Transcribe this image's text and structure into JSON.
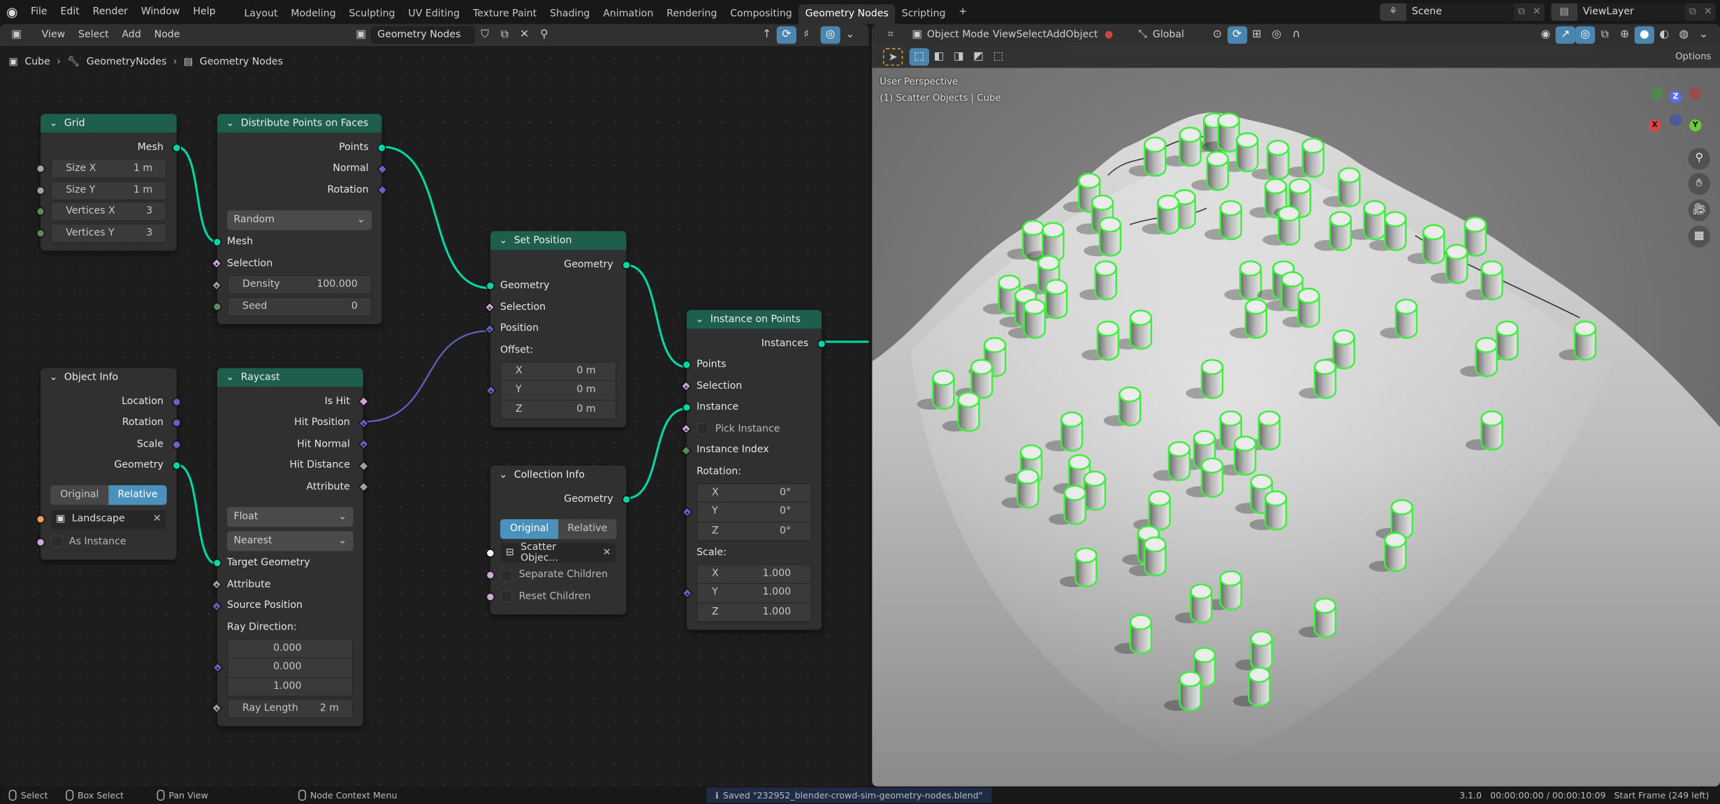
{
  "top_bar": {
    "menu": [
      "File",
      "Edit",
      "Render",
      "Window",
      "Help"
    ],
    "workspaces": [
      "Layout",
      "Modeling",
      "Sculpting",
      "UV Editing",
      "Texture Paint",
      "Shading",
      "Animation",
      "Rendering",
      "Compositing",
      "Geometry Nodes",
      "Scripting"
    ],
    "active_workspace": "Geometry Nodes",
    "add_tab": "+",
    "scene": "Scene",
    "view_layer": "ViewLayer"
  },
  "node_editor": {
    "header_menu": [
      "View",
      "Select",
      "Add",
      "Node"
    ],
    "node_tree": "Geometry Nodes",
    "breadcrumb": [
      "Cube",
      "GeometryNodes",
      "Geometry Nodes"
    ],
    "nodes": [
      {
        "id": "grid",
        "title": "Grid",
        "color": "#1d5e4c",
        "rows": [
          {
            "t": "out",
            "label": "Mesh",
            "s": "geo"
          },
          {
            "t": "field",
            "label": "Size X",
            "value": "1 m",
            "s": "float"
          },
          {
            "t": "field",
            "label": "Size Y",
            "value": "1 m",
            "s": "float"
          },
          {
            "t": "field",
            "label": "Vertices X",
            "value": "3",
            "s": "int"
          },
          {
            "t": "field",
            "label": "Vertices Y",
            "value": "3",
            "s": "int"
          }
        ]
      },
      {
        "id": "distribute",
        "title": "Distribute Points on Faces",
        "color": "#1d5e4c",
        "rows": [
          {
            "t": "out",
            "label": "Points",
            "s": "geo"
          },
          {
            "t": "out",
            "label": "Normal",
            "s": "vec"
          },
          {
            "t": "out",
            "label": "Rotation",
            "s": "vec"
          },
          {
            "t": "drop",
            "value": "Random"
          },
          {
            "t": "in",
            "label": "Mesh",
            "s": "geo"
          },
          {
            "t": "in",
            "label": "Selection",
            "s": "boolf"
          },
          {
            "t": "field",
            "label": "Density",
            "value": "100.000",
            "s": "floatf"
          },
          {
            "t": "field",
            "label": "Seed",
            "value": "0",
            "s": "int"
          }
        ]
      },
      {
        "id": "setpos",
        "title": "Set Position",
        "color": "#1d5e4c",
        "rows": [
          {
            "t": "out",
            "label": "Geometry",
            "s": "geo"
          },
          {
            "t": "in",
            "label": "Geometry",
            "s": "geo"
          },
          {
            "t": "in",
            "label": "Selection",
            "s": "boolf"
          },
          {
            "t": "in",
            "label": "Position",
            "s": "vecd"
          },
          {
            "t": "label",
            "label": "Offset:"
          },
          {
            "t": "vec",
            "s": "vecf",
            "items": [
              [
                "X",
                "0 m"
              ],
              [
                "Y",
                "0 m"
              ],
              [
                "Z",
                "0 m"
              ]
            ]
          }
        ]
      },
      {
        "id": "iop",
        "title": "Instance on Points",
        "color": "#1d5e4c",
        "rows": [
          {
            "t": "out",
            "label": "Instances",
            "s": "geo"
          },
          {
            "t": "in",
            "label": "Points",
            "s": "geo"
          },
          {
            "t": "in",
            "label": "Selection",
            "s": "boolf"
          },
          {
            "t": "in",
            "label": "Instance",
            "s": "geo"
          },
          {
            "t": "check",
            "label": "Pick Instance",
            "s": "boolf"
          },
          {
            "t": "in",
            "label": "Instance Index",
            "s": "intd"
          },
          {
            "t": "label",
            "label": "Rotation:"
          },
          {
            "t": "vec",
            "s": "vecf",
            "items": [
              [
                "X",
                "0°"
              ],
              [
                "Y",
                "0°"
              ],
              [
                "Z",
                "0°"
              ]
            ]
          },
          {
            "t": "label",
            "label": "Scale:"
          },
          {
            "t": "vec",
            "s": "vecf",
            "items": [
              [
                "X",
                "1.000"
              ],
              [
                "Y",
                "1.000"
              ],
              [
                "Z",
                "1.000"
              ]
            ]
          }
        ]
      },
      {
        "id": "objinfo",
        "title": "Object Info",
        "color": "#303030",
        "rows": [
          {
            "t": "out",
            "label": "Location",
            "s": "vecc"
          },
          {
            "t": "out",
            "label": "Rotation",
            "s": "vecc"
          },
          {
            "t": "out",
            "label": "Scale",
            "s": "vecc"
          },
          {
            "t": "out",
            "label": "Geometry",
            "s": "geo"
          },
          {
            "t": "toggle",
            "options": [
              "Original",
              "Relative"
            ],
            "active": 1
          },
          {
            "t": "obj",
            "value": "Landscape",
            "icon": "object",
            "s": "object"
          },
          {
            "t": "check",
            "label": "As Instance",
            "s": "bool"
          }
        ]
      },
      {
        "id": "raycast",
        "title": "Raycast",
        "color": "#1d5e4c",
        "rows": [
          {
            "t": "out",
            "label": "Is Hit",
            "s": "boold"
          },
          {
            "t": "out",
            "label": "Hit Position",
            "s": "vecd"
          },
          {
            "t": "out",
            "label": "Hit Normal",
            "s": "vecd"
          },
          {
            "t": "out",
            "label": "Hit Distance",
            "s": "floatd"
          },
          {
            "t": "out",
            "label": "Attribute",
            "s": "floatd"
          },
          {
            "t": "drop",
            "value": "Float"
          },
          {
            "t": "drop",
            "value": "Nearest"
          },
          {
            "t": "in",
            "label": "Target Geometry",
            "s": "geo"
          },
          {
            "t": "in",
            "label": "Attribute",
            "s": "floatf"
          },
          {
            "t": "in",
            "label": "Source Position",
            "s": "vecd"
          },
          {
            "t": "label",
            "label": "Ray Direction:"
          },
          {
            "t": "vec",
            "s": "vecf",
            "center": true,
            "items": [
              [
                "",
                "0.000"
              ],
              [
                "",
                "0.000"
              ],
              [
                "",
                "1.000"
              ]
            ]
          },
          {
            "t": "field",
            "label": "Ray Length",
            "value": "2 m",
            "s": "floatf"
          }
        ]
      },
      {
        "id": "collinfo",
        "title": "Collection Info",
        "color": "#303030",
        "rows": [
          {
            "t": "out",
            "label": "Geometry",
            "s": "geo"
          },
          {
            "t": "toggle",
            "options": [
              "Original",
              "Relative"
            ],
            "active": 0
          },
          {
            "t": "obj",
            "value": "Scatter Objec...",
            "icon": "collection",
            "s": "collection"
          },
          {
            "t": "check",
            "label": "Separate Children",
            "s": "bool"
          },
          {
            "t": "check",
            "label": "Reset Children",
            "s": "bool"
          }
        ]
      }
    ]
  },
  "viewport": {
    "mode": "Object Mode",
    "header_menu": [
      "View",
      "Select",
      "Add",
      "Object"
    ],
    "orientation": "Global",
    "options": "Options",
    "overlay_line1": "User Perspective",
    "overlay_line2": "(1) Scatter Objects | Cube",
    "gizmo": {
      "x": "X",
      "y": "Y",
      "z": "Z"
    }
  },
  "status_bar": {
    "select": "Select",
    "box_select": "Box Select",
    "pan_view": "Pan View",
    "context_menu": "Node Context Menu",
    "message": "Saved \"232952_blender-crowd-sim-geometry-nodes.blend\"",
    "info": "3.1.0   00:00:00:00 / 00:00:10:09   Start Frame (249 left)"
  },
  "colors": {
    "accent": "#4a92bd",
    "geometry_socket": "#00d6a3",
    "vector_socket": "#6363c7",
    "bool_socket": "#cca6d6",
    "selection_outline": "#3cf03c"
  }
}
